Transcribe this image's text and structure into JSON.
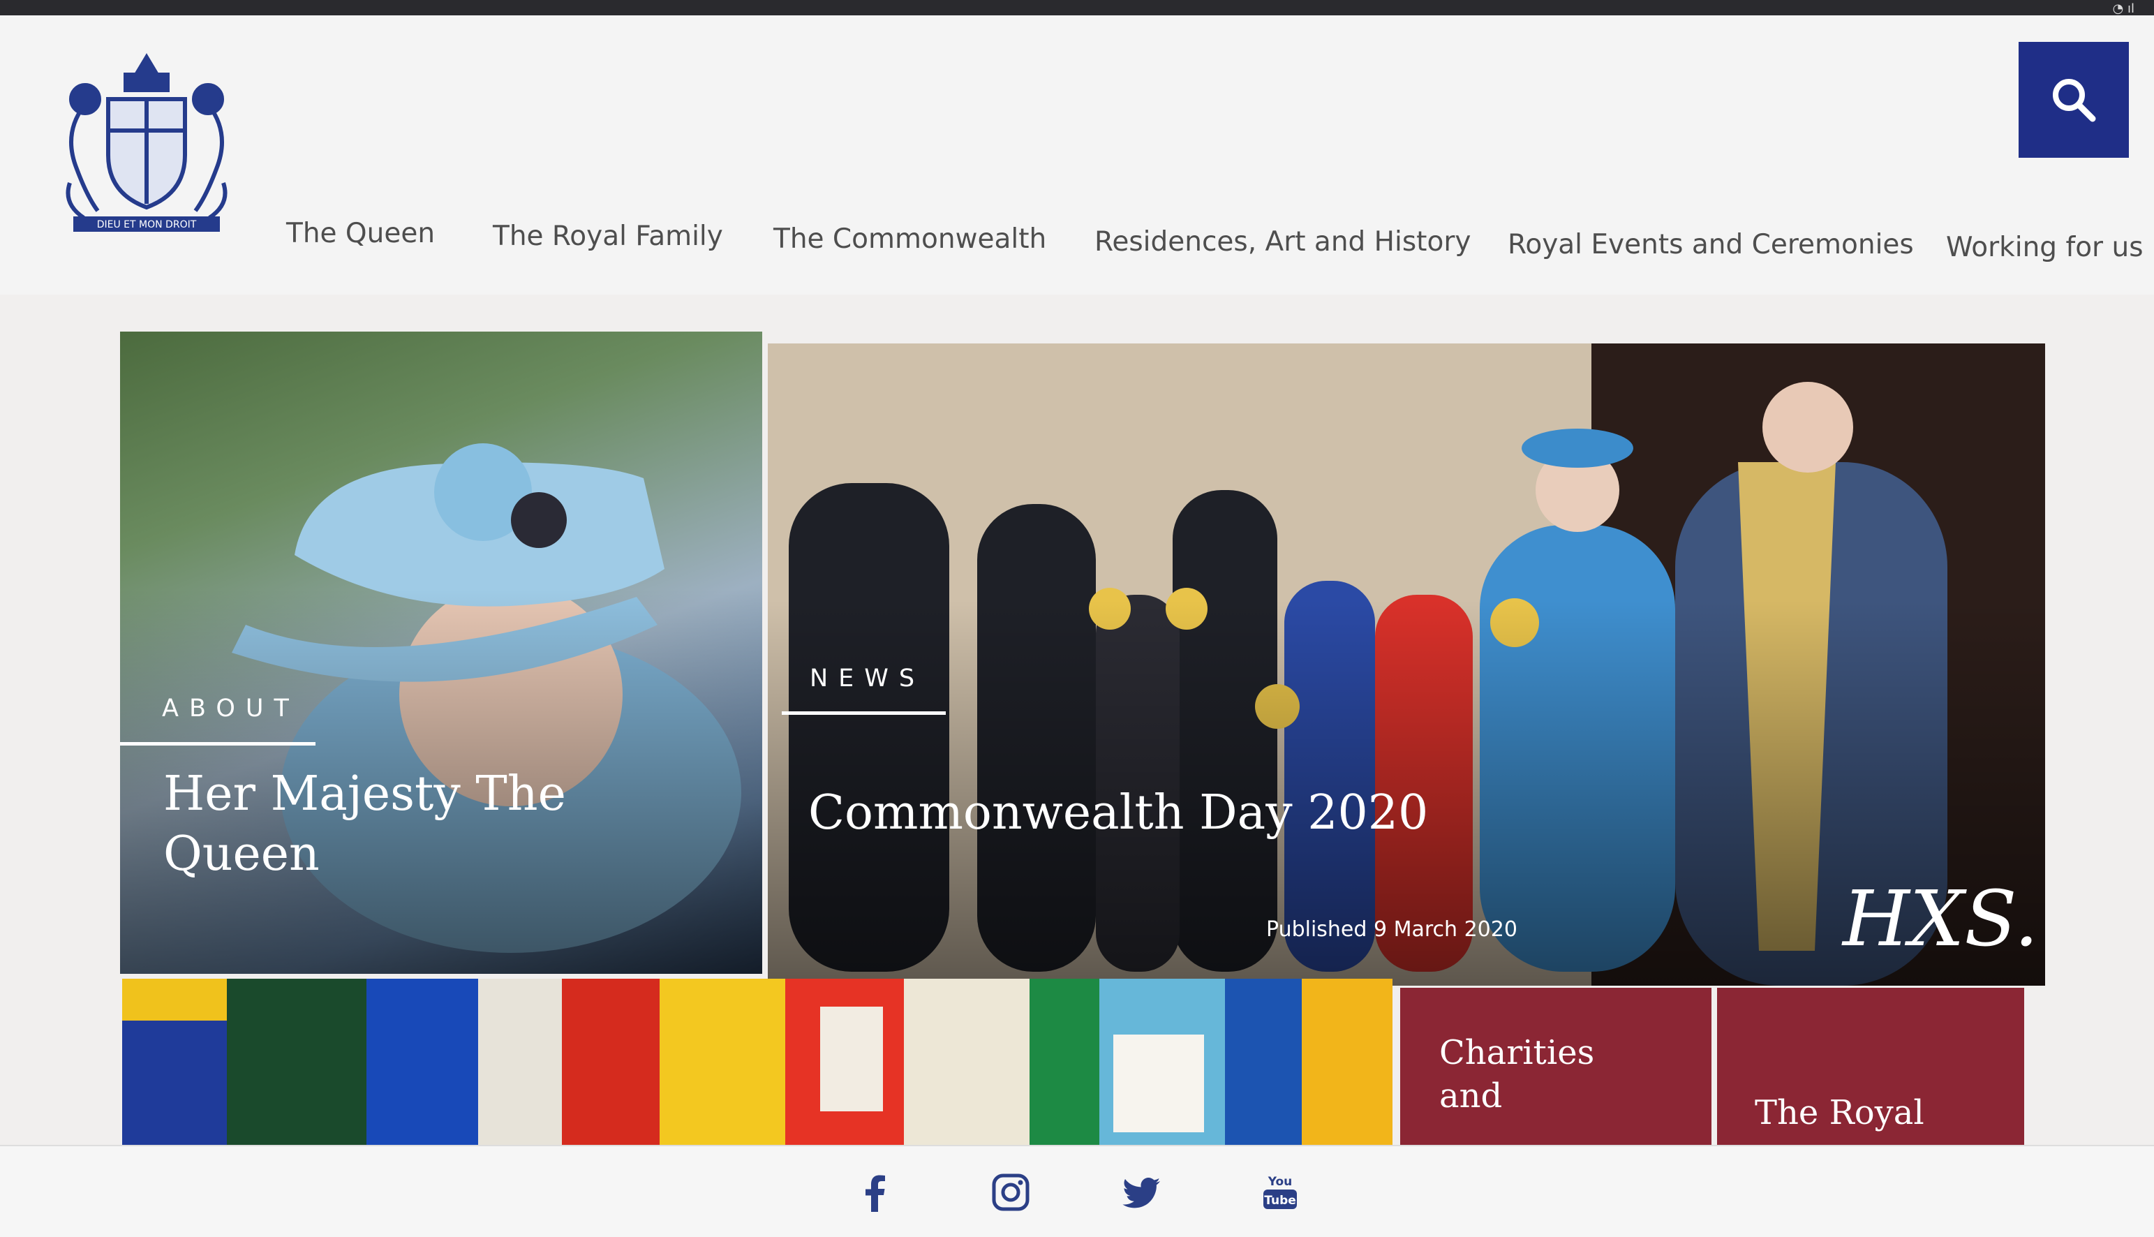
{
  "status": {
    "wifi": "wifi-icon"
  },
  "brand": {
    "crest": "royal-coat-of-arms",
    "motto": "DIEU ET MON DROIT"
  },
  "search": {
    "icon": "search-icon",
    "color": "#1f2e87"
  },
  "nav": {
    "items": [
      "The Queen",
      "The Royal Family",
      "The Commonwealth",
      "Residences, Art and History",
      "Royal Events and Ceremonies",
      "Working for us"
    ]
  },
  "tiles": {
    "about": {
      "kicker": "ABOUT",
      "title_line1": "Her Majesty The",
      "title_line2": "Queen"
    },
    "news": {
      "kicker": "NEWS",
      "title": "Commonwealth Day 2020",
      "published": "Published 9 March 2020",
      "signature": "HXS..."
    },
    "charities": {
      "title_line1": "Charities",
      "title_line2": "and"
    },
    "royal": {
      "title": "The Royal"
    }
  },
  "footer": {
    "social": [
      "facebook-icon",
      "instagram-icon",
      "twitter-icon",
      "youtube-icon"
    ]
  },
  "colors": {
    "accent_blue": "#1f2e87",
    "tile_maroon": "#8b2634",
    "nav_text": "#4e4e4e"
  }
}
